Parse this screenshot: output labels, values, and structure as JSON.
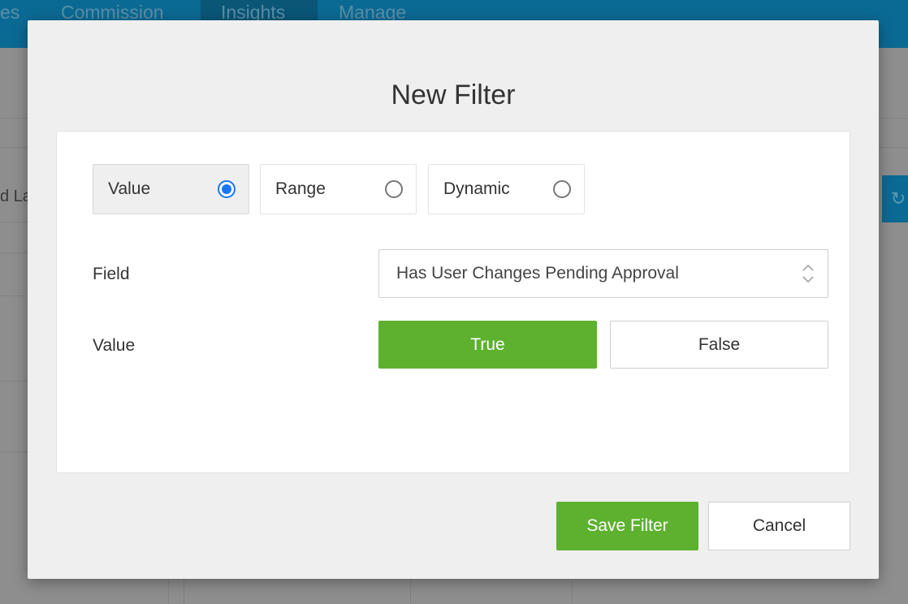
{
  "background": {
    "nav_items": [
      {
        "label": "es"
      },
      {
        "label": "Commission"
      },
      {
        "label": "Insights"
      },
      {
        "label": "Manage"
      }
    ],
    "partial_text": "d La"
  },
  "modal": {
    "title": "New Filter",
    "filter_types": [
      {
        "label": "Value",
        "selected": true
      },
      {
        "label": "Range",
        "selected": false
      },
      {
        "label": "Dynamic",
        "selected": false
      }
    ],
    "field_label": "Field",
    "field_value": "Has User Changes Pending Approval",
    "value_label": "Value",
    "value_options": {
      "true_label": "True",
      "false_label": "False",
      "selected": "True"
    },
    "save_label": "Save Filter",
    "cancel_label": "Cancel"
  },
  "colors": {
    "nav_bg": "#0b6a94",
    "primary_green": "#5db12f",
    "radio_blue": "#1877f2"
  },
  "icons": {
    "select_arrows": "chevron-up-down-icon",
    "refresh": "refresh-icon"
  }
}
